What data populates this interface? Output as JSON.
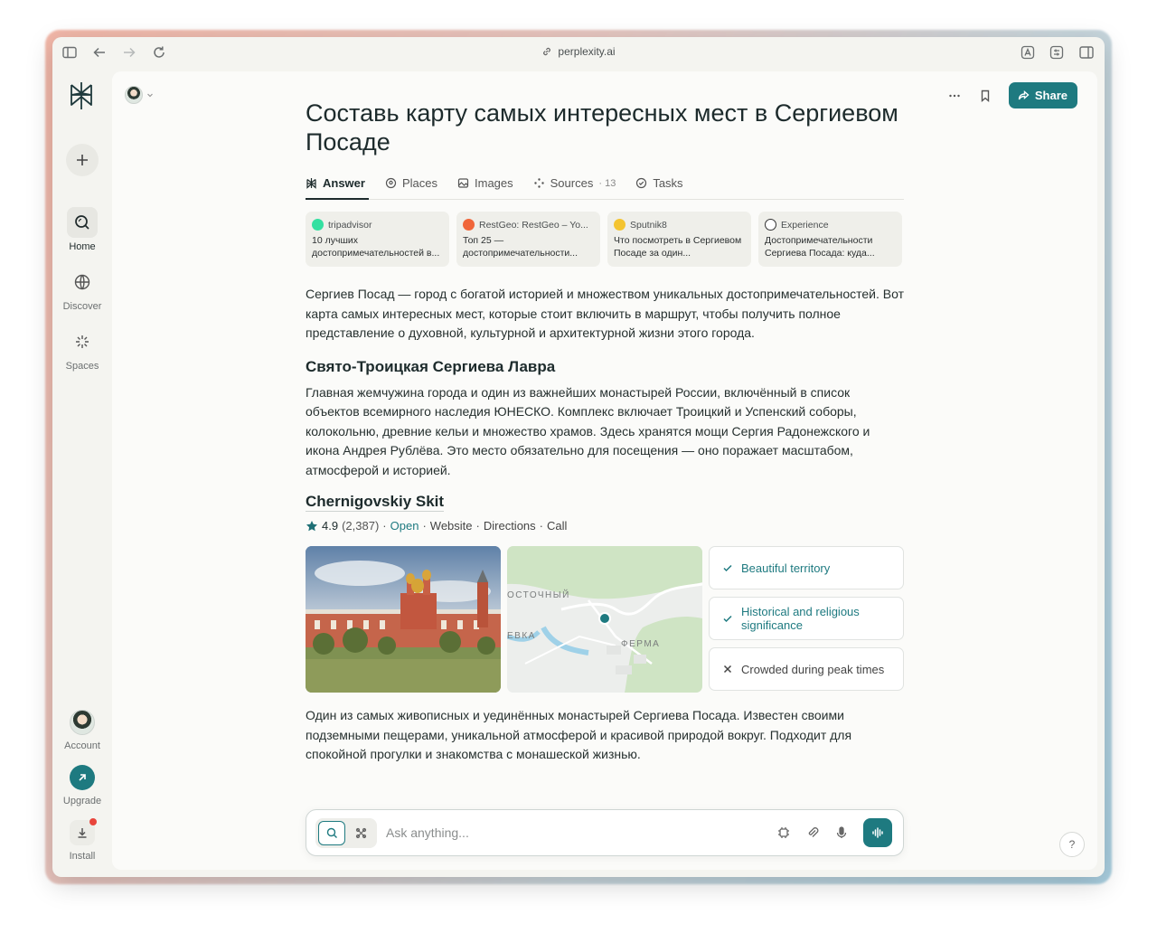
{
  "browser": {
    "url": "perplexity.ai"
  },
  "rail": {
    "items": [
      {
        "label": "Home"
      },
      {
        "label": "Discover"
      },
      {
        "label": "Spaces"
      }
    ],
    "account_label": "Account",
    "upgrade_label": "Upgrade",
    "install_label": "Install"
  },
  "header": {
    "share_label": "Share"
  },
  "thread": {
    "title": "Составь карту самых интересных мест в Сергиевом Посаде",
    "tabs": [
      {
        "label": "Answer",
        "icon": "perplexity-icon"
      },
      {
        "label": "Places",
        "icon": "pin-icon"
      },
      {
        "label": "Images",
        "icon": "image-icon"
      },
      {
        "label": "Sources",
        "icon": "sources-icon",
        "count": "13"
      },
      {
        "label": "Tasks",
        "icon": "check-circle-icon"
      }
    ],
    "sources": [
      {
        "site": "tripadvisor",
        "text": "10 лучших достопримечательностей в...",
        "color": "#34e0a1"
      },
      {
        "site": "RestGeo: RestGeo – Yo...",
        "text": "Топ 25 — достопримечательности...",
        "color": "#f0663a"
      },
      {
        "site": "Sputnik8",
        "text": "Что посмотреть в Сергиевом Посаде за один...",
        "color": "#f4c430"
      },
      {
        "site": "Experience",
        "text": "Достопримечательности Сергиева Посада: куда...",
        "color": "#d14a2b"
      }
    ],
    "intro": "Сергиев Посад — город с богатой историей и множеством уникальных достопримечательностей. Вот карта самых интересных мест, которые стоит включить в маршрут, чтобы получить полное представление о духовной, культурной и архитектурной жизни этого города.",
    "section_title": "Свято-Троицкая Сергиева Лавра",
    "section_text": "Главная жемчужина города и один из важнейших монастырей России, включённый в список объектов всемирного наследия ЮНЕСКО. Комплекс включает Троицкий и Успенский соборы, колокольню, древние кельи и множество храмов. Здесь хранятся мощи Сергия Радонежского и икона Андрея Рублёва. Это место обязательно для посещения — оно поражает масштабом, атмосферой и историей.",
    "place": {
      "name": "Chernigovskiy Skit",
      "rating": "4.9",
      "reviews": "(2,387)",
      "status": "Open",
      "links": [
        "Website",
        "Directions",
        "Call"
      ],
      "map_labels": [
        "ОСТОЧНЫЙ",
        "ЕВКА",
        "ФЕРМА"
      ],
      "pros": [
        {
          "text": "Beautiful territory",
          "type": "good"
        },
        {
          "text": "Historical and religious significance",
          "type": "good"
        },
        {
          "text": "Crowded during peak times",
          "type": "bad"
        }
      ],
      "description": "Один из самых живописных и уединённых монастырей Сергиева Посада. Известен своими подземными пещерами, уникальной атмосферой и красивой природой вокруг. Подходит для спокойной прогулки и знакомства с монашеской жизнью."
    }
  },
  "ask": {
    "placeholder": "Ask anything..."
  },
  "help": "?",
  "colors": {
    "accent": "#1e7a80",
    "panel": "#fbfbf9"
  }
}
